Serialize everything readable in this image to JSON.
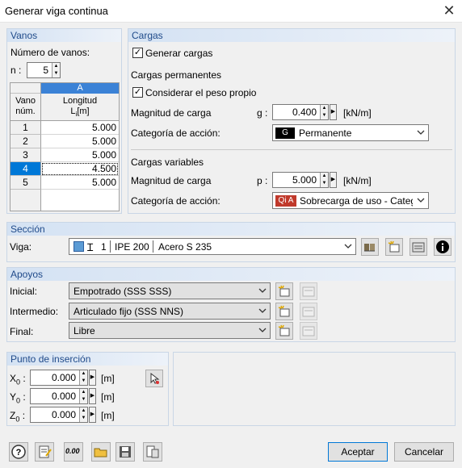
{
  "window": {
    "title": "Generar viga continua",
    "close_glyph": "✕"
  },
  "vanos": {
    "header": "Vanos",
    "count_label": "Número de vanos:",
    "n_label": "n :",
    "n_value": "5",
    "col_letter": "A",
    "col_vano_1": "Vano",
    "col_vano_2": "núm.",
    "col_long_1": "Longitud",
    "col_long_2": "L",
    "col_long_sub": "i",
    "col_long_unit": "[m]",
    "rows": [
      {
        "num": "1",
        "len": "5.000"
      },
      {
        "num": "2",
        "len": "5.000"
      },
      {
        "num": "3",
        "len": "5.000"
      },
      {
        "num": "4",
        "len": "4.500"
      },
      {
        "num": "5",
        "len": "5.000"
      }
    ],
    "selected_row": 3
  },
  "cargas": {
    "header": "Cargas",
    "generate_label": "Generar cargas",
    "generate_checked": true,
    "perm_title": "Cargas permanentes",
    "selfweight_label": "Considerar el peso propio",
    "selfweight_checked": true,
    "perm_mag_label": "Magnitud de carga",
    "perm_sym": "g :",
    "perm_value": "0.400",
    "perm_unit": "[kN/m]",
    "perm_cat_label": "Categoría de acción:",
    "perm_cat_badge": "G",
    "perm_cat_text": "Permanente",
    "var_title": "Cargas variables",
    "var_mag_label": "Magnitud de carga",
    "var_sym": "p :",
    "var_value": "5.000",
    "var_unit": "[kN/m]",
    "var_cat_label": "Categoría de acción:",
    "var_cat_badge": "Qi A",
    "var_cat_text": "Sobrecarga de uso - Categoría",
    "perm_badge_color": "#000000",
    "var_badge_color": "#c0392b"
  },
  "seccion": {
    "header": "Sección",
    "viga_label": "Viga:",
    "num": "1",
    "profile": "IPE 200",
    "material": "Acero S 235",
    "swatch_color": "#5b9bd5"
  },
  "apoyos": {
    "header": "Apoyos",
    "inicial_label": "Inicial:",
    "inicial_value": "Empotrado (SSS SSS)",
    "intermedio_label": "Intermedio:",
    "intermedio_value": "Articulado fijo (SSS NNS)",
    "final_label": "Final:",
    "final_value": "Libre"
  },
  "insercion": {
    "header": "Punto de inserción",
    "x_label": "X",
    "x_sub": "0",
    "x_value": "0.000",
    "y_label": "Y",
    "y_sub": "0",
    "y_value": "0.000",
    "z_label": "Z",
    "z_sub": "0",
    "z_value": "0.000",
    "unit": "[m]"
  },
  "footer": {
    "units_icon_text": "0.00",
    "accept_label": "Aceptar",
    "cancel_label": "Cancelar"
  },
  "colors": {
    "accent": "#0078d7",
    "group_header_text": "#1f4a8a"
  }
}
